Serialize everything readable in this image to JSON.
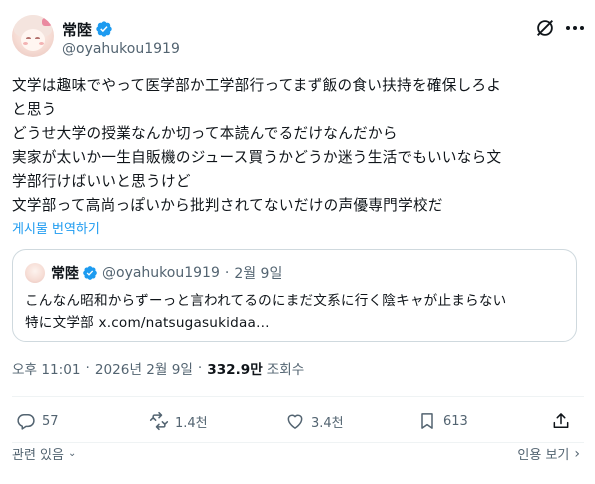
{
  "author": {
    "display_name": "常陸",
    "handle": "@oyahukou1919"
  },
  "tweet": {
    "lines": [
      "文学は趣味でやって医学部か工学部行ってまず飯の食い扶持を確保しろよ",
      "と思う",
      "どうせ大学の授業なんか切って本読んでるだけなんだから",
      "実家が太いか一生自販機のジュース買うかどうか迷う生活でもいいなら文",
      "学部行けばいいと思うけど",
      "文学部って高尚っぽいから批判されてないだけの声優専門学校だ"
    ],
    "translate_label": "게시물 번역하기"
  },
  "quote": {
    "display_name": "常陸",
    "handle": "@oyahukou1919",
    "separator": "·",
    "date": "2월 9일",
    "lines": [
      "こんなん昭和からずーっと言われてるのにまだ文系に行く陰キャが止まらない",
      "特に文学部 x.com/natsugasukidaa…"
    ]
  },
  "meta": {
    "time": "오후 11:01",
    "dot1": "·",
    "date": "2026년 2월 9일",
    "dot2": "·",
    "views": "332.9만",
    "views_label": "조회수"
  },
  "actions": {
    "replies": "57",
    "reposts": "1.4천",
    "likes": "3.4천",
    "bookmarks": "613"
  },
  "footer": {
    "related_label": "관련 있음",
    "related_chevron": "⌄",
    "more_label": "인용 보기",
    "more_chevron": "›"
  },
  "colors": {
    "text": "#0f1419",
    "secondary": "#536471",
    "link": "#1d9bf0",
    "verified": "#1d9bf0",
    "border": "#cfd9de",
    "divider": "#eff3f4"
  }
}
